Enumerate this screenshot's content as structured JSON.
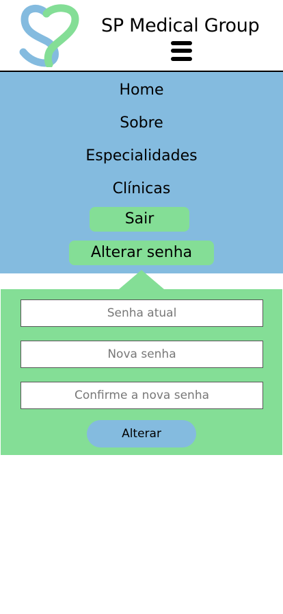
{
  "header": {
    "brand": "SP Medical Group",
    "logo_icon": "sp-heart-logo-icon",
    "menu_icon": "hamburger-menu-icon"
  },
  "nav": {
    "items": [
      {
        "label": "Home"
      },
      {
        "label": "Sobre"
      },
      {
        "label": "Especialidades"
      },
      {
        "label": "Clínicas"
      }
    ],
    "logout_label": "Sair",
    "change_password_label": "Alterar senha"
  },
  "change_password_form": {
    "current_placeholder": "Senha atual",
    "new_placeholder": "Nova senha",
    "confirm_placeholder": "Confirme a nova senha",
    "submit_label": "Alterar"
  },
  "colors": {
    "blue": "#84bbdf",
    "green": "#84de96"
  }
}
